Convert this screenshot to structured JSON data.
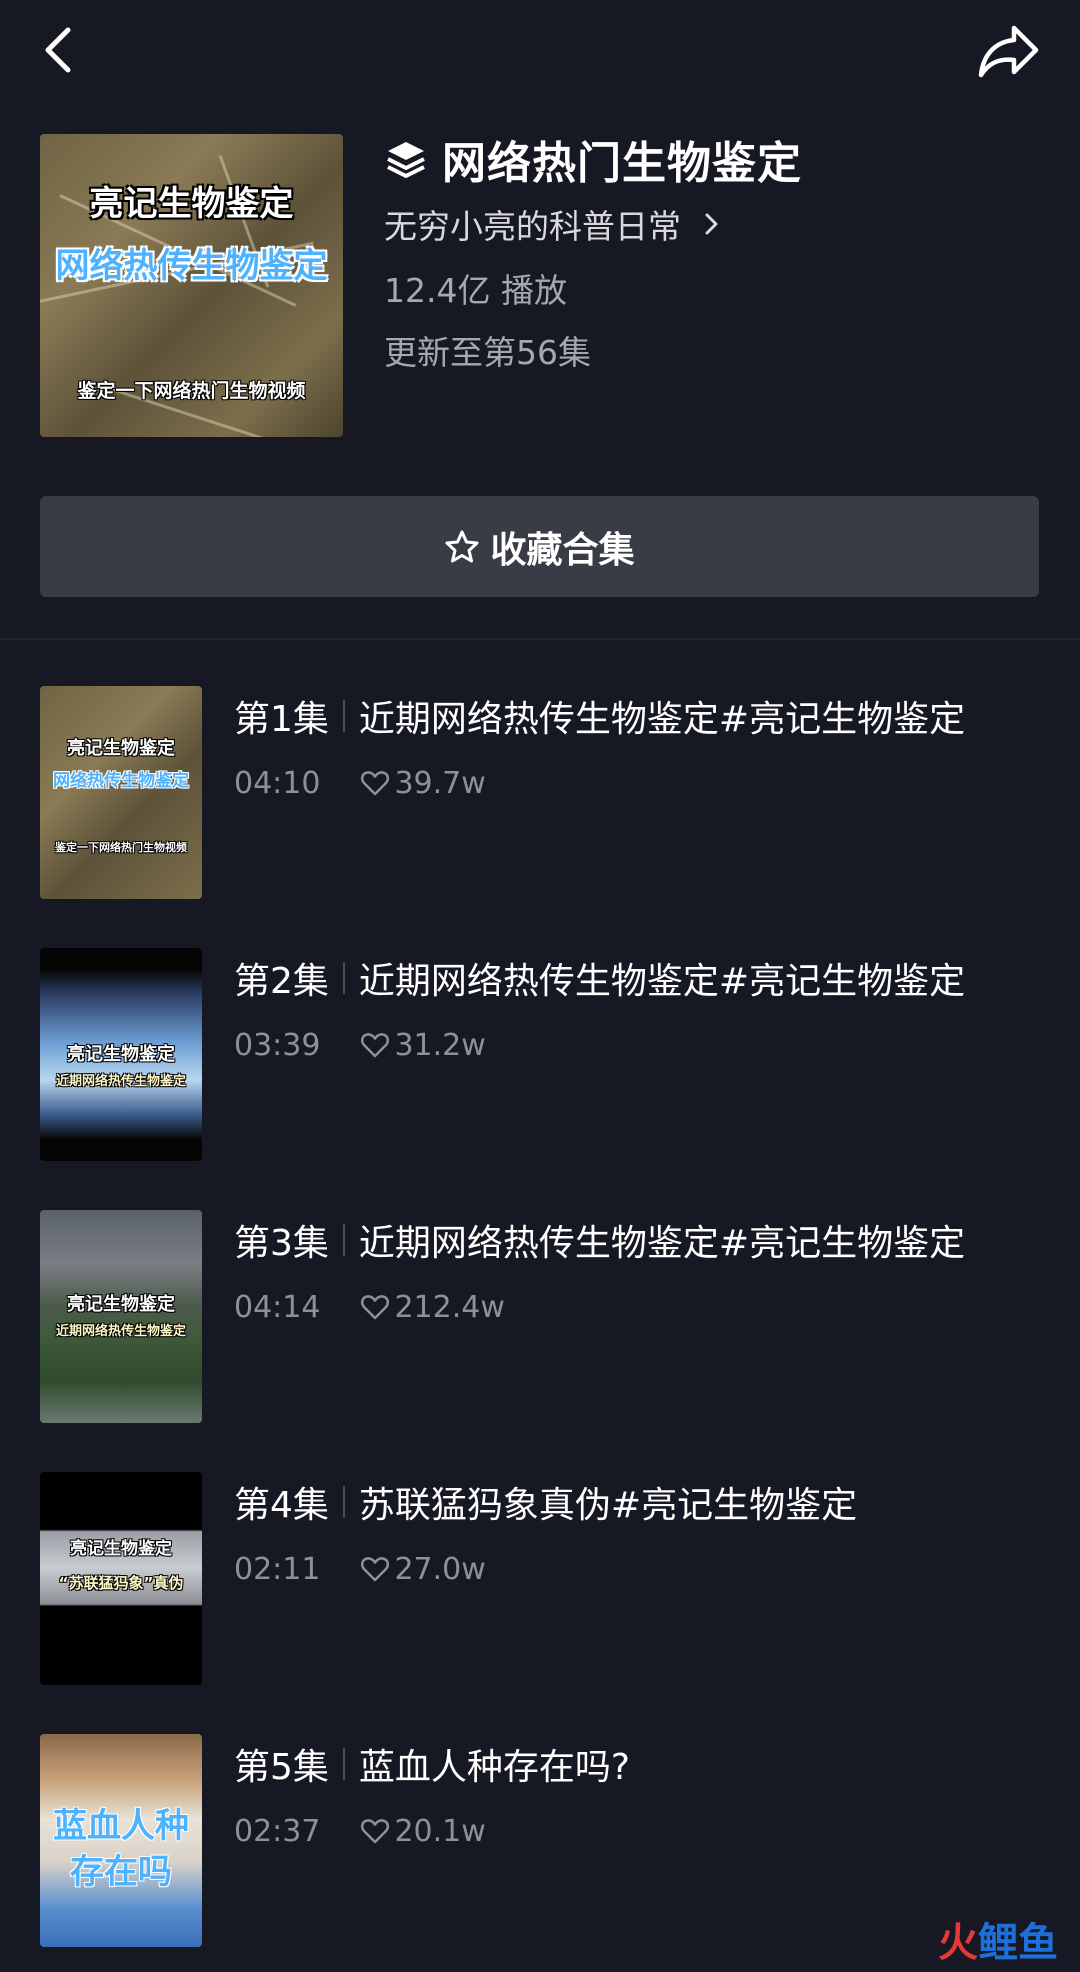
{
  "header": {
    "title": "网络热门生物鉴定",
    "author": "无穷小亮的科普日常",
    "plays": "12.4亿 播放",
    "updated": "更新至第56集",
    "cover": {
      "line1": "亮记生物鉴定",
      "line2": "网络热传生物鉴定",
      "line3": "鉴定一下网络热门生物视频"
    }
  },
  "favorite_button": {
    "label": "收藏合集"
  },
  "icons": {
    "back": "chevron-left-icon",
    "share": "share-arrow-icon",
    "collection": "layers-icon",
    "favorite": "star-outline-icon",
    "like": "heart-outline-icon"
  },
  "episodes": [
    {
      "num": "第1集",
      "title": "近期网络热传生物鉴定#亮记生物鉴定",
      "duration": "04:10",
      "likes": "39.7w",
      "thumb": {
        "line1": "亮记生物鉴定",
        "line2": "网络热传生物鉴定",
        "line3": "鉴定一下网络热门生物视频"
      }
    },
    {
      "num": "第2集",
      "title": "近期网络热传生物鉴定#亮记生物鉴定",
      "duration": "03:39",
      "likes": "31.2w",
      "thumb": {
        "line1": "亮记生物鉴定",
        "line2": "近期网络热传生物鉴定"
      }
    },
    {
      "num": "第3集",
      "title": "近期网络热传生物鉴定#亮记生物鉴定",
      "duration": "04:14",
      "likes": "212.4w",
      "thumb": {
        "line1": "亮记生物鉴定",
        "line2": "近期网络热传生物鉴定"
      }
    },
    {
      "num": "第4集",
      "title": "苏联猛犸象真伪#亮记生物鉴定",
      "duration": "02:11",
      "likes": "27.0w",
      "thumb": {
        "line1": "亮记生物鉴定",
        "line2": "“苏联猛犸象”真伪"
      }
    },
    {
      "num": "第5集",
      "title": "蓝血人种存在吗?",
      "duration": "02:37",
      "likes": "20.1w",
      "thumb": {
        "line1": "蓝血人种",
        "line2": "存在吗"
      }
    }
  ],
  "watermark": {
    "part1": "火",
    "part2": "鲤鱼"
  },
  "colors": {
    "background": "#161823",
    "button": "#393b45",
    "secondary_text": "#a7a8ae",
    "meta_text": "#8f9097",
    "cover_blue_text": "#4fb2ff"
  }
}
